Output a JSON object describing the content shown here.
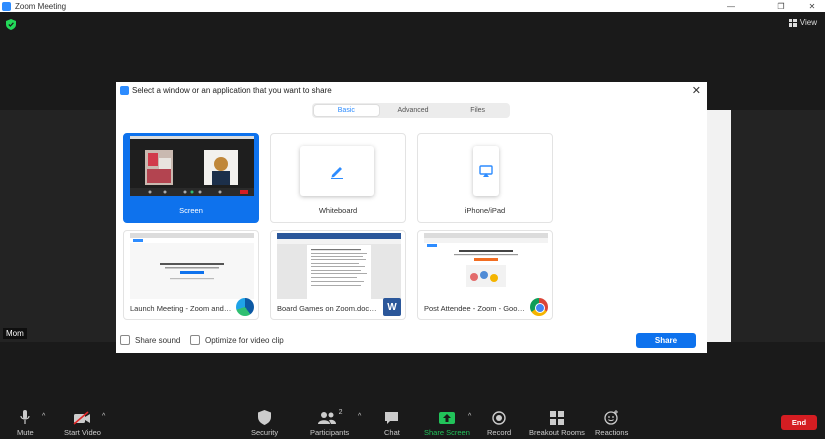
{
  "window": {
    "title": "Zoom Meeting"
  },
  "top_bar": {
    "view_label": "View"
  },
  "participant": {
    "name": "Mom"
  },
  "dialog": {
    "title": "Select a window or an application that you want to share",
    "tabs": [
      {
        "label": "Basic",
        "active": true
      },
      {
        "label": "Advanced",
        "active": false
      },
      {
        "label": "Files",
        "active": false
      }
    ],
    "tiles": [
      {
        "label": "Screen",
        "selected": true
      },
      {
        "label": "Whiteboard",
        "selected": false
      },
      {
        "label": "iPhone/iPad",
        "selected": false
      },
      {
        "label": "Launch Meeting - Zoom and 5 m...",
        "app_icon": "edge-icon"
      },
      {
        "label": "Board Games on Zoom.docx - W...",
        "app_icon": "word-icon"
      },
      {
        "label": "Post Attendee - Zoom - Google ...",
        "app_icon": "chrome-icon"
      }
    ],
    "share_sound_label": "Share sound",
    "optimize_label": "Optimize for video clip",
    "share_button_label": "Share",
    "accent_color": "#0e72ed"
  },
  "toolbar": {
    "items": [
      {
        "label": "Mute",
        "icon": "microphone-icon"
      },
      {
        "label": "Start Video",
        "icon": "video-off-icon"
      },
      {
        "label": "Security",
        "icon": "shield-icon"
      },
      {
        "label": "Participants",
        "icon": "participants-icon",
        "count": "2"
      },
      {
        "label": "Chat",
        "icon": "chat-icon"
      },
      {
        "label": "Share Screen",
        "icon": "share-screen-icon"
      },
      {
        "label": "Record",
        "icon": "record-icon"
      },
      {
        "label": "Breakout Rooms",
        "icon": "breakout-rooms-icon"
      },
      {
        "label": "Reactions",
        "icon": "reactions-icon"
      }
    ],
    "end_label": "End",
    "end_color": "#d51d22",
    "share_color": "#22c35a"
  }
}
